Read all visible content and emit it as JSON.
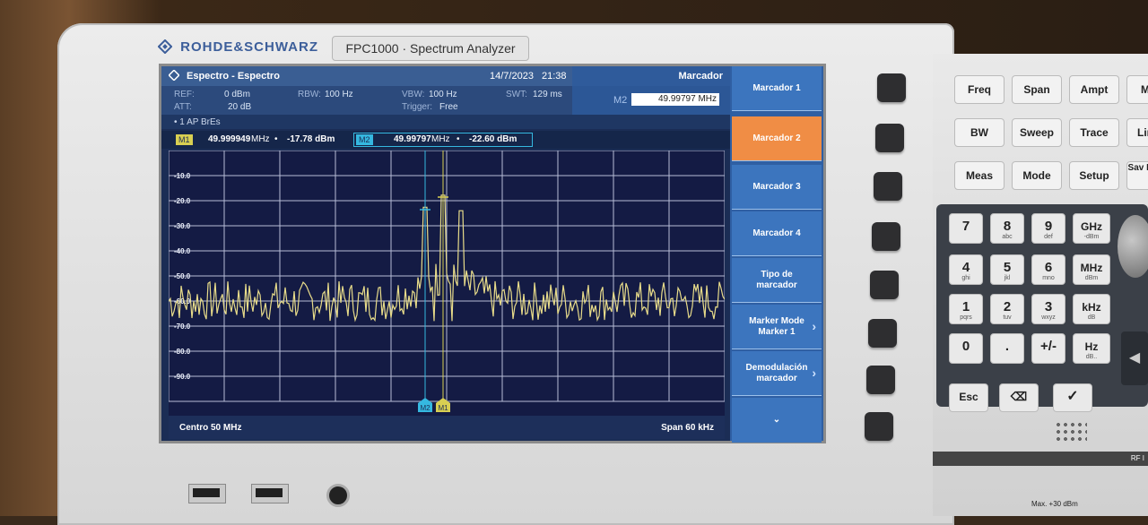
{
  "device": {
    "brand": "ROHDE&SCHWARZ",
    "model": "FPC1000 · Spectrum Analyzer"
  },
  "header": {
    "title": "Espectro - Espectro",
    "date": "14/7/2023",
    "time": "21:38",
    "panel_title": "Marcador"
  },
  "params": {
    "ref_label": "REF:",
    "ref_value": "0 dBm",
    "att_label": "ATT:",
    "att_value": "20 dB",
    "rbw_label": "RBW:",
    "rbw_value": "100 Hz",
    "vbw_label": "VBW:",
    "vbw_value": "100 Hz",
    "trigger_label": "Trigger:",
    "trigger_value": "Free",
    "swt_label": "SWT:",
    "swt_value": "129 ms"
  },
  "marker_entry": {
    "label": "M2",
    "value": "49.99797 MHz"
  },
  "trace_info": "• 1 AP  BrEs",
  "markers": {
    "m1": {
      "tag": "M1",
      "freq": "49.999949",
      "unit": "MHz",
      "sep": "•",
      "level": "-17.78 dBm"
    },
    "m2": {
      "tag": "M2",
      "freq": "49.99797",
      "unit": "MHz",
      "sep": "•",
      "level": "-22.60 dBm"
    }
  },
  "plot": {
    "y_ticks": [
      "-10.0",
      "-20.0",
      "-30.0",
      "-40.0",
      "-50.0",
      "-60.0",
      "-70.0",
      "-80.0",
      "-90.0"
    ],
    "marker_flags": [
      "M2",
      "M1"
    ]
  },
  "footer": {
    "center": "Centro 50 MHz",
    "span": "Span 60 kHz"
  },
  "softkeys": [
    {
      "label": "Marcador 1"
    },
    {
      "label": "Marcador 2"
    },
    {
      "label": "Marcador 3"
    },
    {
      "label": "Marcador 4"
    },
    {
      "label": "Tipo de marcador"
    },
    {
      "label": "Marker Mode Marker 1"
    },
    {
      "label": "Demodulación marcador"
    },
    {
      "label": "⌄"
    }
  ],
  "keypad": {
    "row1": [
      "Freq",
      "Span",
      "Ampt",
      "M"
    ],
    "row2": [
      "BW",
      "Sweep",
      "Trace",
      "Lin"
    ],
    "row3": [
      "Meas",
      "Mode",
      "Setup",
      "Sav Rec"
    ],
    "digits": [
      {
        "d": "7",
        "s": ""
      },
      {
        "d": "8",
        "s": "abc"
      },
      {
        "d": "9",
        "s": "def"
      },
      {
        "d": "4",
        "s": "ghi"
      },
      {
        "d": "5",
        "s": "jkl"
      },
      {
        "d": "6",
        "s": "mno"
      },
      {
        "d": "1",
        "s": "pqrs"
      },
      {
        "d": "2",
        "s": "tuv"
      },
      {
        "d": "3",
        "s": "wxyz"
      },
      {
        "d": "0",
        "s": ""
      },
      {
        "d": ".",
        "s": ""
      },
      {
        "d": "+/-",
        "s": ""
      }
    ],
    "units": [
      {
        "u": "GHz",
        "s": "-dBm"
      },
      {
        "u": "MHz",
        "s": "dBm"
      },
      {
        "u": "kHz",
        "s": "dB"
      },
      {
        "u": "Hz",
        "s": "dB.."
      }
    ],
    "esc": "Esc",
    "rf_label": "RF I",
    "warning": "Max. +30 dBm"
  },
  "chart_data": {
    "type": "line",
    "title": "",
    "xlabel": "",
    "ylabel": "",
    "x_center_mhz": 50,
    "span_khz": 60,
    "ylim": [
      -100,
      0
    ],
    "series": [
      {
        "values": []
      }
    ]
  },
  "colors": {
    "active_softkey": "#f08d45",
    "trace": "#e8dc8a",
    "m1": "#d8cf52",
    "m2": "#35b8e0"
  }
}
